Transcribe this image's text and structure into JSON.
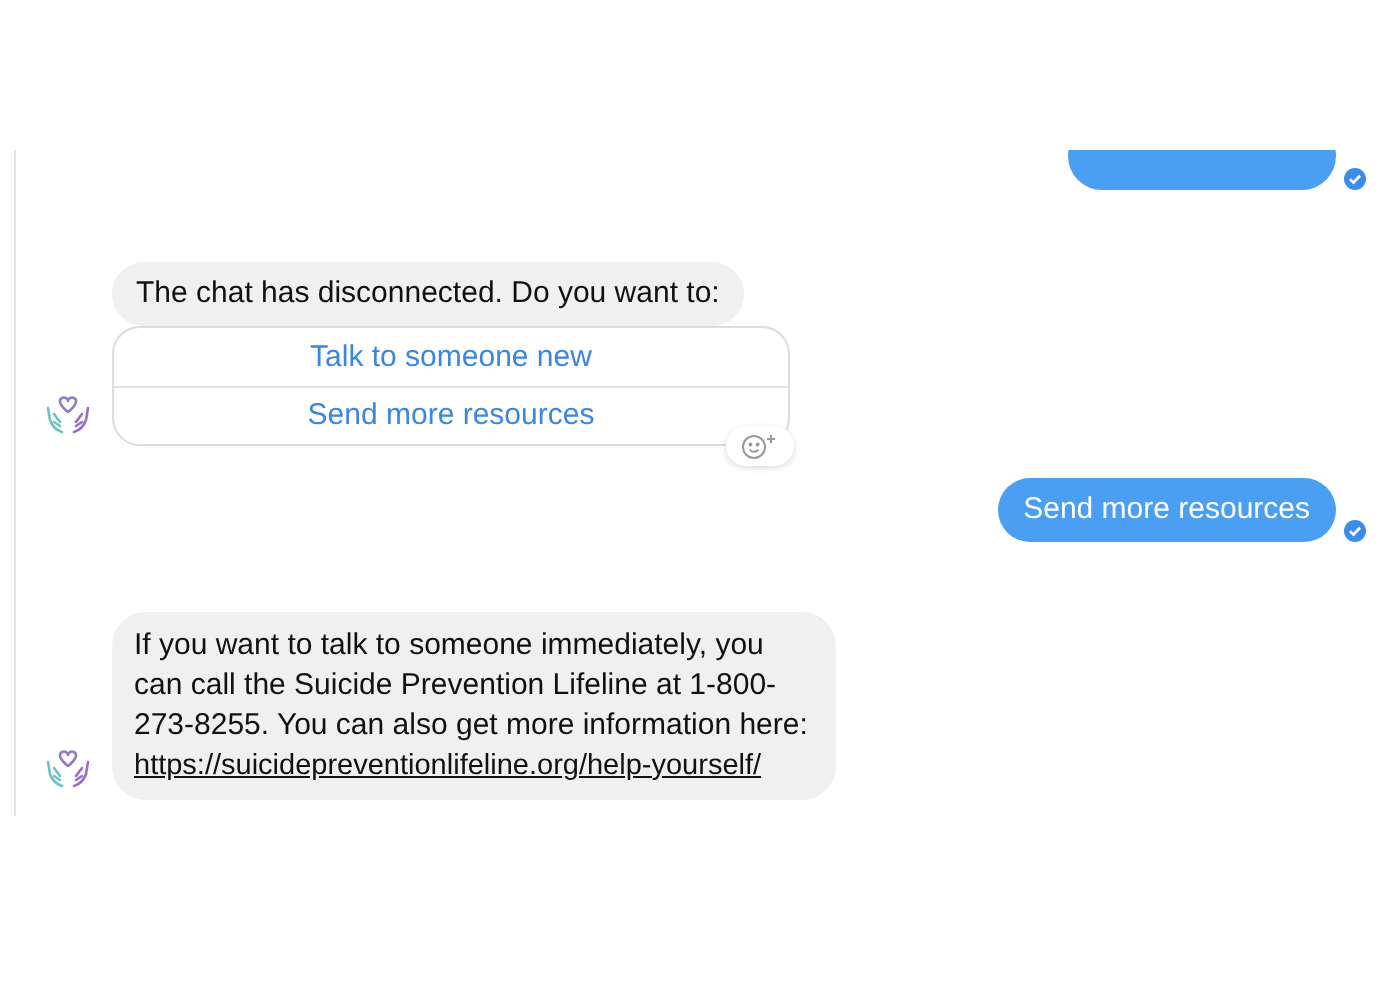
{
  "messages": [
    {
      "kind": "outgoing",
      "delivered": true
    },
    {
      "kind": "quick_replies",
      "text": "The chat has disconnected. Do you want to:",
      "options": [
        "Talk to someone new",
        "Send more resources"
      ],
      "reaction_button": true
    },
    {
      "kind": "outgoing",
      "text": "Send more resources",
      "delivered": true
    },
    {
      "kind": "incoming",
      "text": "If you want to talk to someone immediately, you can call the Suicide Prevention Lifeline at 1-800-273-8255. You can also get more information here:",
      "link": "https://suicidepreventionlifeline.org/help-yourself/"
    }
  ]
}
